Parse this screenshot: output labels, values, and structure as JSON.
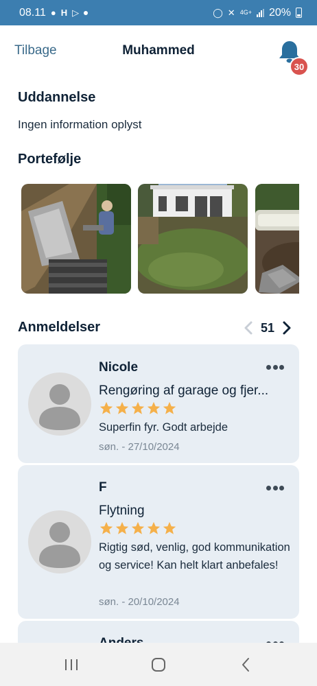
{
  "status_bar": {
    "time": "08.11",
    "battery": "20%",
    "network": "4G+"
  },
  "header": {
    "back_label": "Tilbage",
    "title": "Muhammed",
    "notification_count": "30"
  },
  "education": {
    "title": "Uddannelse",
    "text": "Ingen information oplyst"
  },
  "portfolio": {
    "title": "Portefølje"
  },
  "reviews": {
    "title": "Anmeldelser",
    "count": "51",
    "items": [
      {
        "name": "Nicole",
        "task": "Rengøring af garage og fjer...",
        "rating": 5,
        "text": "Superfin fyr. Godt arbejde",
        "date": "søn. - 27/10/2024"
      },
      {
        "name": "F",
        "task": "Flytning",
        "rating": 5,
        "text": "Rigtig sød, venlig, god kommunikation og service! Kan helt klart anbefales!",
        "date": "søn. - 20/10/2024"
      },
      {
        "name": "Anders"
      }
    ]
  },
  "colors": {
    "status_bar": "#3c7eb0",
    "accent": "#2a6f9e",
    "card_bg": "#e8eef4",
    "star": "#f5b04a",
    "badge": "#d9534f"
  }
}
